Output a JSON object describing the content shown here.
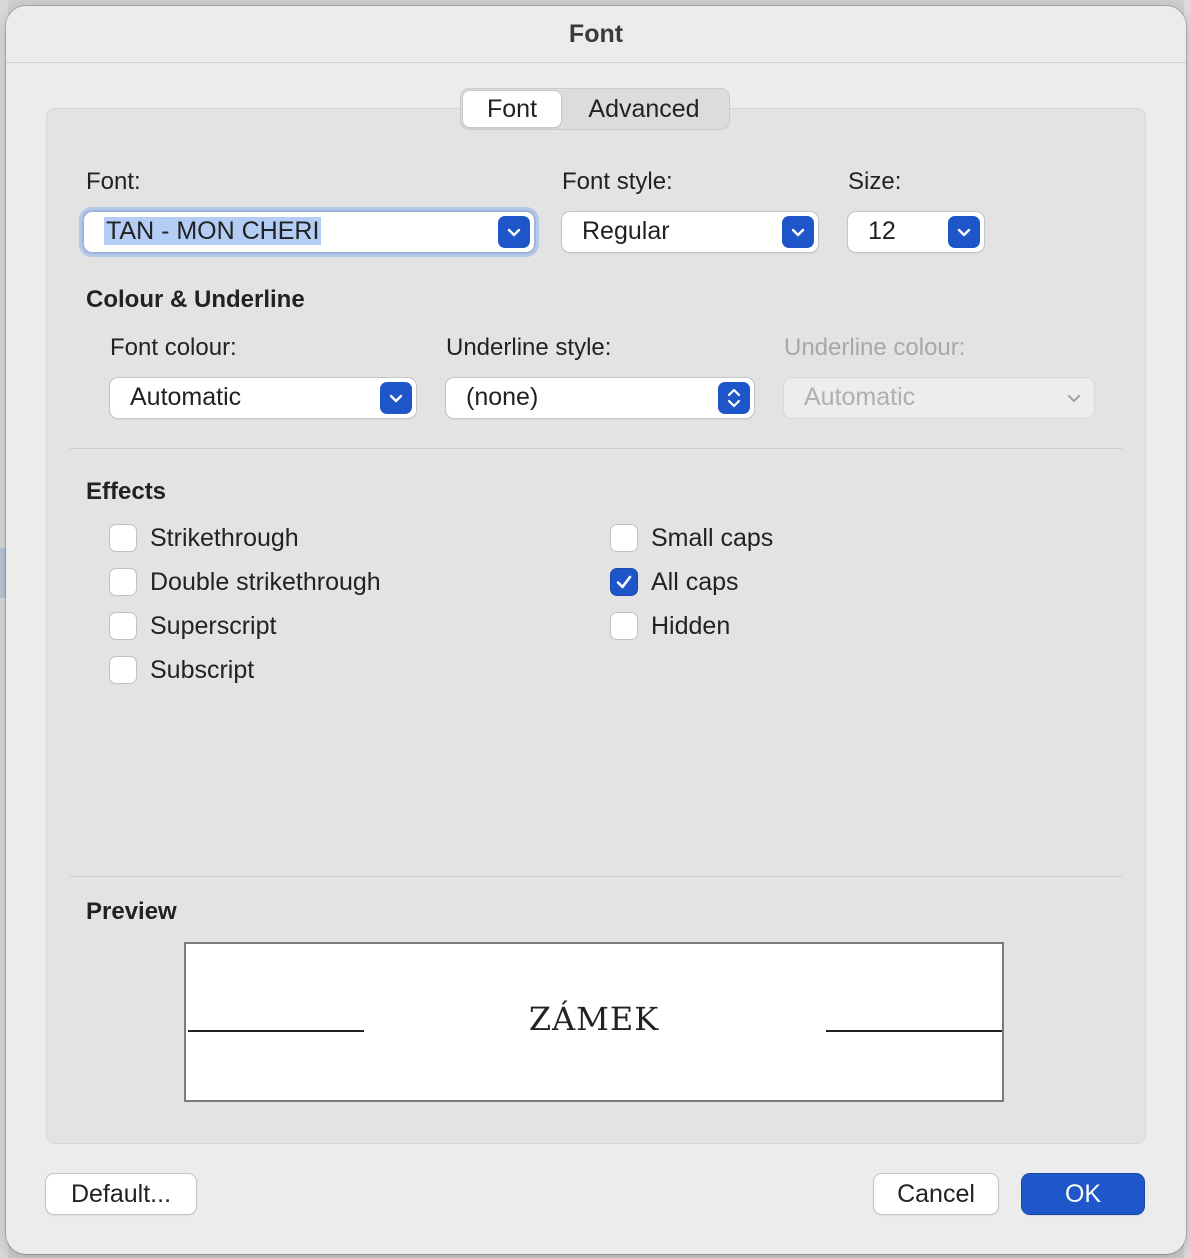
{
  "window": {
    "title": "Font"
  },
  "tabs": [
    {
      "label": "Font",
      "active": true
    },
    {
      "label": "Advanced",
      "active": false
    }
  ],
  "font_section": {
    "font_label": "Font:",
    "font_value": "TAN - MON CHERI",
    "style_label": "Font style:",
    "style_value": "Regular",
    "size_label": "Size:",
    "size_value": "12"
  },
  "colour_underline": {
    "heading": "Colour & Underline",
    "font_colour_label": "Font colour:",
    "font_colour_value": "Automatic",
    "underline_style_label": "Underline style:",
    "underline_style_value": "(none)",
    "underline_colour_label": "Underline colour:",
    "underline_colour_value": "Automatic"
  },
  "effects": {
    "heading": "Effects",
    "items": [
      {
        "label": "Strikethrough",
        "checked": false
      },
      {
        "label": "Double strikethrough",
        "checked": false
      },
      {
        "label": "Superscript",
        "checked": false
      },
      {
        "label": "Subscript",
        "checked": false
      },
      {
        "label": "Small caps",
        "checked": false
      },
      {
        "label": "All caps",
        "checked": true
      },
      {
        "label": "Hidden",
        "checked": false
      }
    ]
  },
  "preview": {
    "heading": "Preview",
    "sample_text": "ZÁMEK"
  },
  "buttons": {
    "default_label": "Default...",
    "cancel_label": "Cancel",
    "ok_label": "OK"
  },
  "colors": {
    "accent": "#1e55c8",
    "window_bg": "#ececec",
    "panel_bg": "#e3e3e3"
  }
}
